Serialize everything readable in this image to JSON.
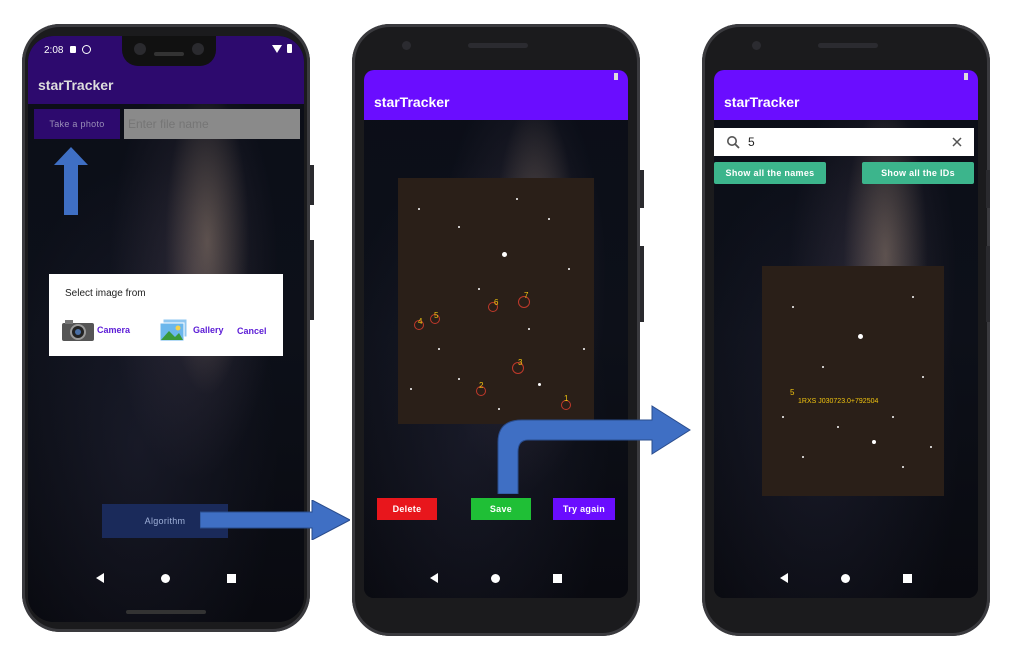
{
  "phone1": {
    "status_time": "2:08",
    "app_title": "starTracker",
    "take_photo_label": "Take a photo",
    "filename_placeholder": "Enter file name",
    "dialog": {
      "title": "Select image from",
      "camera_label": "Camera",
      "gallery_label": "Gallery",
      "cancel_label": "Cancel"
    },
    "algorithm_label": "Algorithm"
  },
  "phone2": {
    "app_title": "starTracker",
    "star_markers": [
      "1",
      "2",
      "3",
      "4",
      "5",
      "6",
      "7"
    ],
    "delete_label": "Delete",
    "save_label": "Save",
    "try_again_label": "Try again"
  },
  "phone3": {
    "app_title": "starTracker",
    "search_value": "5",
    "show_names_label": "Show all the names",
    "show_ids_label": "Show all the IDs",
    "star_marker": "5",
    "star_id": "1RXS J030723.0+792504"
  },
  "colors": {
    "appbar_dark": "#2d0a6e",
    "appbar": "#6a0dff",
    "delete": "#e8161c",
    "save": "#1fbf36",
    "try_again": "#6a0dff",
    "teal": "#3cb58c",
    "arrow": "#3f6fc4"
  },
  "icons": [
    "camera-icon",
    "gallery-icon",
    "search-icon",
    "close-icon",
    "battery-icon",
    "wifi-icon",
    "back-nav-icon",
    "home-nav-icon",
    "recents-nav-icon"
  ]
}
